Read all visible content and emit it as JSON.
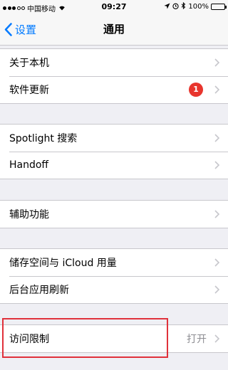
{
  "status_bar": {
    "carrier": "中国移动",
    "time": "09:27",
    "battery": "100%",
    "battery_level": 1.0
  },
  "nav": {
    "back_label": "设置",
    "title": "通用"
  },
  "groups": [
    {
      "rows": [
        {
          "label": "关于本机"
        },
        {
          "label": "软件更新",
          "badge": "1"
        }
      ]
    },
    {
      "rows": [
        {
          "label": "Spotlight 搜索"
        },
        {
          "label": "Handoff"
        }
      ]
    },
    {
      "rows": [
        {
          "label": "辅助功能"
        }
      ]
    },
    {
      "rows": [
        {
          "label": "储存空间与 iCloud 用量"
        },
        {
          "label": "后台应用刷新"
        }
      ]
    },
    {
      "rows": [
        {
          "label": "访问限制",
          "value": "打开"
        }
      ]
    }
  ],
  "colors": {
    "accent": "#007aff",
    "badge": "#e8352d",
    "highlight": "#e0313b",
    "background": "#efeff4"
  },
  "icons": [
    "signal-dots",
    "wifi-icon",
    "location-icon",
    "alarm-icon",
    "bluetooth-icon",
    "battery-icon",
    "back-chevron-icon",
    "chevron-right-icon"
  ]
}
